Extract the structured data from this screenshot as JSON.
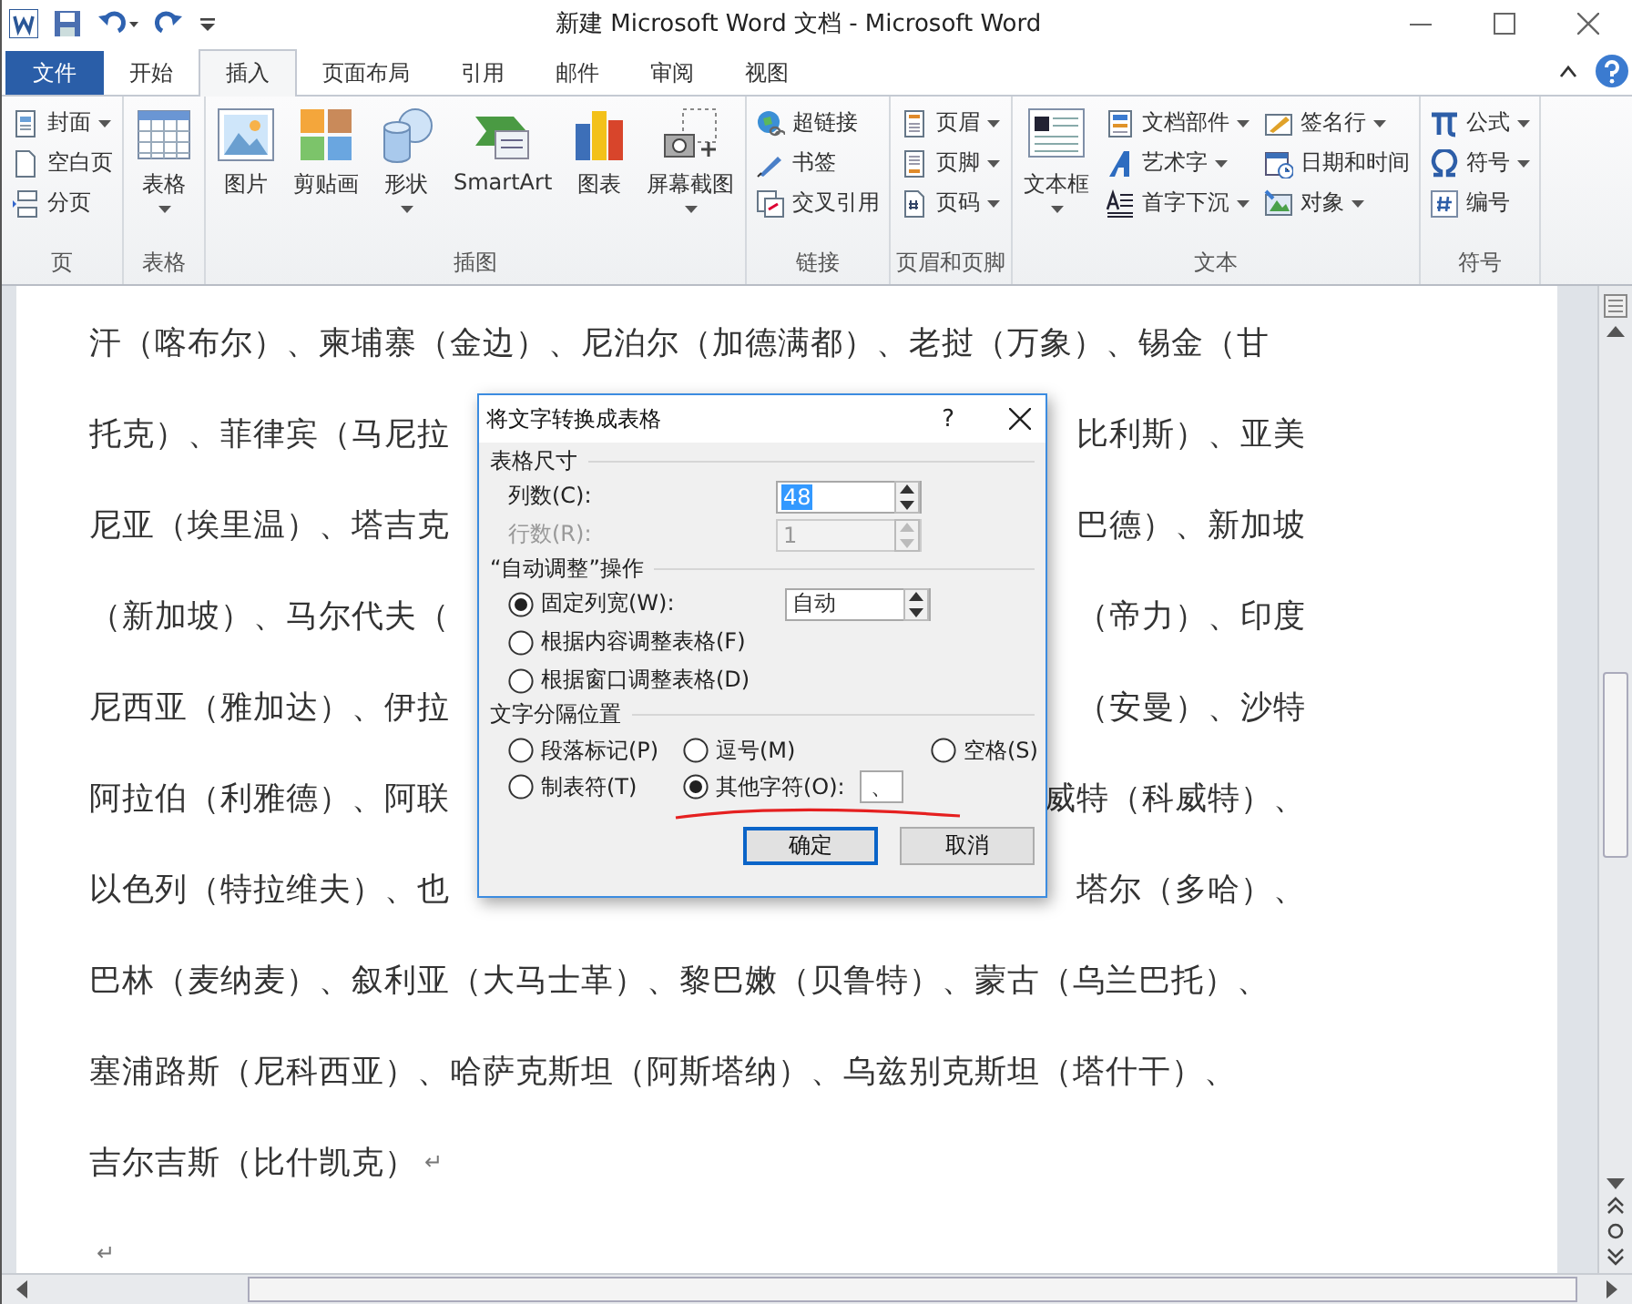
{
  "window": {
    "title": "新建 Microsoft Word 文档 - Microsoft Word"
  },
  "tabs": [
    {
      "label": "文件",
      "kind": "file",
      "selected": false
    },
    {
      "label": "开始",
      "kind": "tab",
      "selected": false
    },
    {
      "label": "插入",
      "kind": "tab",
      "selected": true
    },
    {
      "label": "页面布局",
      "kind": "tab",
      "selected": false
    },
    {
      "label": "引用",
      "kind": "tab",
      "selected": false
    },
    {
      "label": "邮件",
      "kind": "tab",
      "selected": false
    },
    {
      "label": "审阅",
      "kind": "tab",
      "selected": false
    },
    {
      "label": "视图",
      "kind": "tab",
      "selected": false
    }
  ],
  "ribbon_groups": [
    {
      "label": "页",
      "items": [
        {
          "label": "封面",
          "kind": "small",
          "dropdown": true
        },
        {
          "label": "空白页",
          "kind": "small",
          "dropdown": false
        },
        {
          "label": "分页",
          "kind": "small",
          "dropdown": false
        }
      ]
    },
    {
      "label": "表格",
      "items": [
        {
          "label": "表格",
          "kind": "large",
          "dropdown": true
        }
      ]
    },
    {
      "label": "插图",
      "items": [
        {
          "label": "图片",
          "kind": "large",
          "dropdown": false
        },
        {
          "label": "剪贴画",
          "kind": "large",
          "dropdown": false
        },
        {
          "label": "形状",
          "kind": "large",
          "dropdown": true
        },
        {
          "label": "SmartArt",
          "kind": "large",
          "dropdown": false
        },
        {
          "label": "图表",
          "kind": "large",
          "dropdown": false
        },
        {
          "label": "屏幕截图",
          "kind": "large",
          "dropdown": true
        }
      ]
    },
    {
      "label": "链接",
      "items": [
        {
          "label": "超链接",
          "kind": "small",
          "dropdown": false
        },
        {
          "label": "书签",
          "kind": "small",
          "dropdown": false
        },
        {
          "label": "交叉引用",
          "kind": "small",
          "dropdown": false
        }
      ]
    },
    {
      "label": "页眉和页脚",
      "items": [
        {
          "label": "页眉",
          "kind": "small",
          "dropdown": true
        },
        {
          "label": "页脚",
          "kind": "small",
          "dropdown": true
        },
        {
          "label": "页码",
          "kind": "small",
          "dropdown": true
        }
      ]
    },
    {
      "label": "文本",
      "items": [
        {
          "label": "文本框",
          "kind": "large",
          "dropdown": true
        },
        {
          "label": "文档部件",
          "kind": "small",
          "dropdown": true
        },
        {
          "label": "艺术字",
          "kind": "small",
          "dropdown": true
        },
        {
          "label": "首字下沉",
          "kind": "small",
          "dropdown": true
        },
        {
          "label": "签名行",
          "kind": "small",
          "dropdown": true
        },
        {
          "label": "日期和时间",
          "kind": "small",
          "dropdown": false
        },
        {
          "label": "对象",
          "kind": "small",
          "dropdown": true
        }
      ]
    },
    {
      "label": "符号",
      "items": [
        {
          "label": "公式",
          "kind": "small",
          "dropdown": true
        },
        {
          "label": "符号",
          "kind": "small",
          "dropdown": true
        },
        {
          "label": "编号",
          "kind": "small",
          "dropdown": false
        }
      ]
    }
  ],
  "document": {
    "lines": [
      {
        "left": "汗（喀布尔）、柬埔寨（金边）、尼泊尔（加德满都）、老挝（万象）、锡金（甘"
      },
      {
        "left": "托克）、菲律宾（马尼拉",
        "right": "比利斯）、亚美"
      },
      {
        "left": "尼亚（埃里温）、塔吉克",
        "right": "巴德）、新加坡"
      },
      {
        "left": "（新加坡）、马尔代夫（",
        "right": "（帝力）、印度"
      },
      {
        "left": "尼西亚（雅加达）、伊拉",
        "right": "（安曼）、沙特"
      },
      {
        "left": "阿拉伯（利雅德）、阿联",
        "right": "威特（科威特）、"
      },
      {
        "left": "以色列（特拉维夫）、也",
        "right": "塔尔（多哈）、"
      },
      {
        "left": "巴林（麦纳麦）、叙利亚（大马士革）、黎巴嫩（贝鲁特）、蒙古（乌兰巴托）、"
      },
      {
        "left": "塞浦路斯（尼科西亚）、哈萨克斯坦（阿斯塔纳）、乌兹别克斯坦（塔什干）、"
      },
      {
        "left": "吉尔吉斯（比什凯克）",
        "end_mark": "↵"
      },
      {
        "end_mark": "↵"
      }
    ]
  },
  "dialog": {
    "title": "将文字转换成表格",
    "help": "?",
    "table_size": {
      "heading": "表格尺寸",
      "fields": [
        {
          "label": "列数(C):",
          "value": "48",
          "disabled": false,
          "highlighted": true
        },
        {
          "label": "行数(R):",
          "value": "1",
          "disabled": true,
          "highlighted": false
        }
      ]
    },
    "autofit": {
      "heading": "“自动调整”操作",
      "options": [
        {
          "label": "固定列宽(W):",
          "selected": true,
          "value": "自动"
        },
        {
          "label": "根据内容调整表格(F)",
          "selected": false
        },
        {
          "label": "根据窗口调整表格(D)",
          "selected": false
        }
      ]
    },
    "separator": {
      "heading": "文字分隔位置",
      "options": [
        {
          "label": "段落标记(P)",
          "selected": false
        },
        {
          "label": "逗号(M)",
          "selected": false
        },
        {
          "label": "空格(S)",
          "selected": false
        },
        {
          "label": "制表符(T)",
          "selected": false
        },
        {
          "label": "其他字符(O):",
          "selected": true,
          "value": "、"
        }
      ]
    },
    "buttons": [
      {
        "label": "确定",
        "default": true
      },
      {
        "label": "取消",
        "default": false
      }
    ]
  }
}
